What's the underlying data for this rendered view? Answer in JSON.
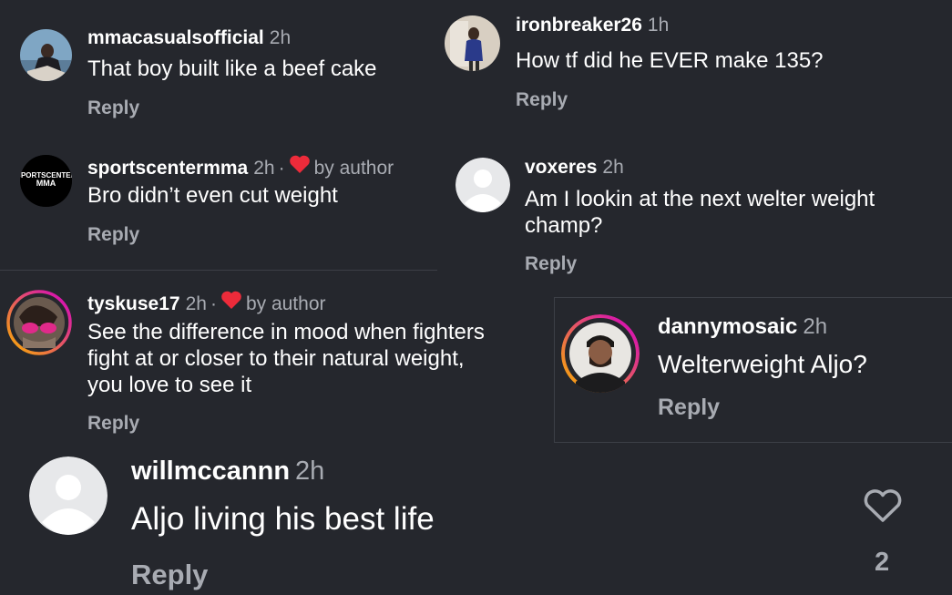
{
  "comments": [
    {
      "username": "mmacasualsofficial",
      "time": "2h",
      "text": "That boy built like a beef cake",
      "reply": "Reply"
    },
    {
      "username": "ironbreaker26",
      "time": "1h",
      "text": "How tf did he EVER make 135?",
      "reply": "Reply"
    },
    {
      "username": "sportscentermma",
      "time": "2h",
      "separator": "·",
      "liked_by_author": "by author",
      "text": "Bro didn’t even cut weight",
      "reply": "Reply",
      "avatar_text": [
        "SPORTSCENTER",
        "MMA"
      ]
    },
    {
      "username": "voxeres",
      "time": "2h",
      "text_lines": [
        "Am I lookin at the next welter weight",
        "champ?"
      ],
      "reply": "Reply"
    },
    {
      "username": "tyskuse17",
      "time": "2h",
      "separator": "·",
      "liked_by_author": "by author",
      "text_lines": [
        "See the difference in mood when fighters",
        "fight at or closer to their natural weight,",
        "you love to see it"
      ],
      "reply": "Reply"
    },
    {
      "username": "dannymosaic",
      "time": "2h",
      "text": "Welterweight Aljo?",
      "reply": "Reply"
    },
    {
      "username": "willmccannn",
      "time": "2h",
      "text": "Aljo living his best life",
      "reply": "Reply",
      "like_count": "2"
    }
  ],
  "colors": {
    "background": "#25272d",
    "secondary_text": "#a8abb2",
    "heart_red": "#ed2b3a",
    "story_ring_start": "#f9b000",
    "story_ring_end": "#d300c5"
  },
  "icons": {
    "author_like": "heart-filled-icon",
    "like": "heart-outline-icon",
    "default_avatar": "default-avatar-icon"
  }
}
